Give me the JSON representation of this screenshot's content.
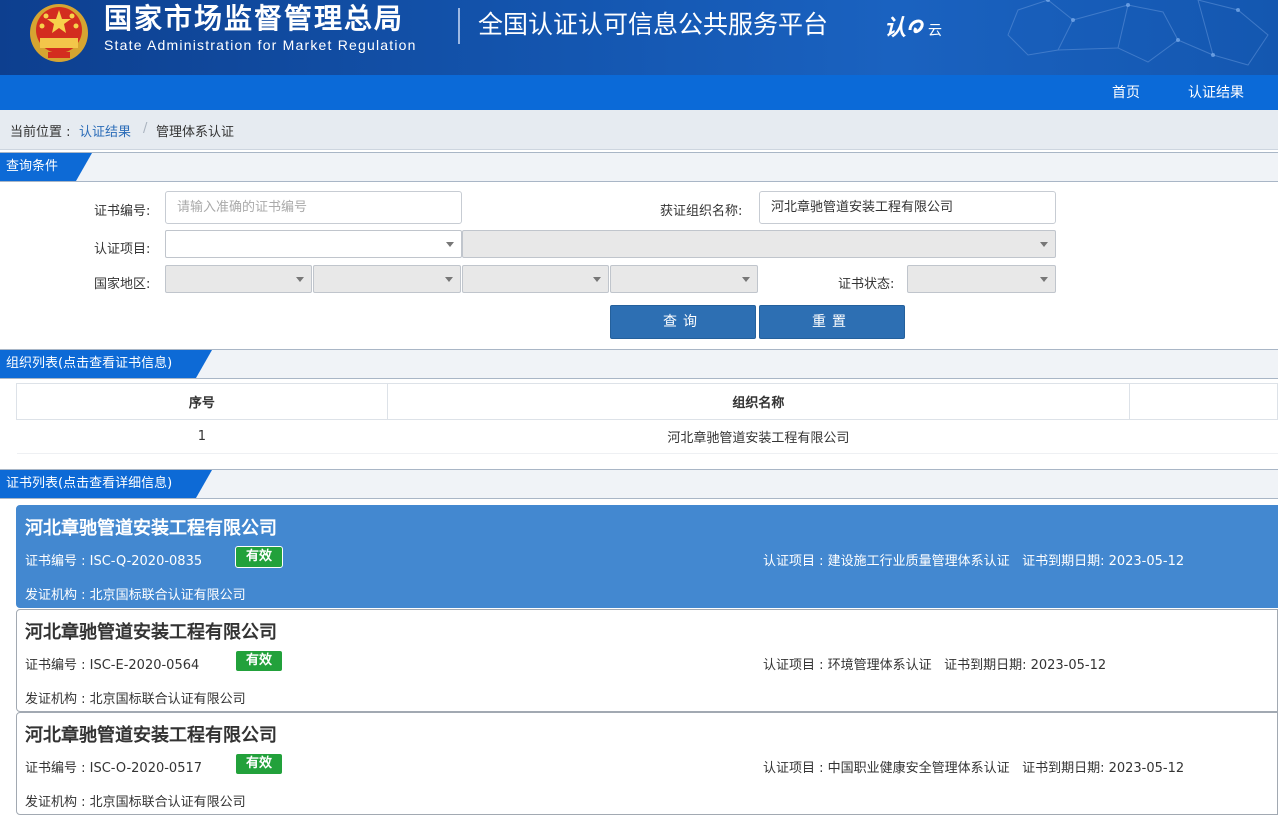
{
  "header": {
    "agency_cn": "国家市场监督管理总局",
    "agency_en": "State Administration  for  Market Regulation",
    "platform_title": "全国认证认可信息公共服务平台",
    "cloud_logo_main": "认",
    "cloud_logo_sub": "云",
    "emblem_icon": "national-emblem-icon"
  },
  "nav": {
    "items": [
      "首页",
      "认证结果"
    ]
  },
  "breadcrumb": {
    "prefix": "当前位置 :",
    "link": "认证结果",
    "sep": "/",
    "current": "管理体系认证"
  },
  "query": {
    "title": "查询条件",
    "cert_no_label": "证书编号:",
    "cert_no_placeholder": "请输入准确的证书编号",
    "org_name_label": "获证组织名称:",
    "org_name_value": "河北章驰管道安装工程有限公司",
    "project_label": "认证项目:",
    "region_label": "国家地区:",
    "status_label": "证书状态:",
    "search_button": "查询",
    "reset_button": "重置"
  },
  "org_list": {
    "title": "组织列表(点击查看证书信息)",
    "columns": [
      "序号",
      "组织名称",
      ""
    ],
    "rows": [
      {
        "index": "1",
        "name": "河北章驰管道安装工程有限公司"
      }
    ]
  },
  "cert_list": {
    "title": "证书列表(点击查看详细信息)",
    "items": [
      {
        "org": "河北章驰管道安装工程有限公司",
        "cert_no": "证书编号 : ISC-Q-2020-0835",
        "status": "有效",
        "project": "认证项目 : 建设施工行业质量管理体系认证",
        "expiry": "证书到期日期: 2023-05-12",
        "issuer": "发证机构 : 北京国标联合认证有限公司"
      },
      {
        "org": "河北章驰管道安装工程有限公司",
        "cert_no": "证书编号 : ISC-E-2020-0564",
        "status": "有效",
        "project": "认证项目 : 环境管理体系认证",
        "expiry": "证书到期日期: 2023-05-12",
        "issuer": "发证机构 : 北京国标联合认证有限公司"
      },
      {
        "org": "河北章驰管道安装工程有限公司",
        "cert_no": "证书编号 : ISC-O-2020-0517",
        "status": "有效",
        "project": "认证项目 : 中国职业健康安全管理体系认证",
        "expiry": "证书到期日期: 2023-05-12",
        "issuer": "发证机构 : 北京国标联合认证有限公司"
      }
    ]
  },
  "colors": {
    "banner": "#1456b0",
    "nav": "#0b6ad8",
    "section_tab": "#0d6ad6",
    "button": "#2d6fb3",
    "active_card": "#4388d0",
    "badge_green": "#22a13b"
  }
}
